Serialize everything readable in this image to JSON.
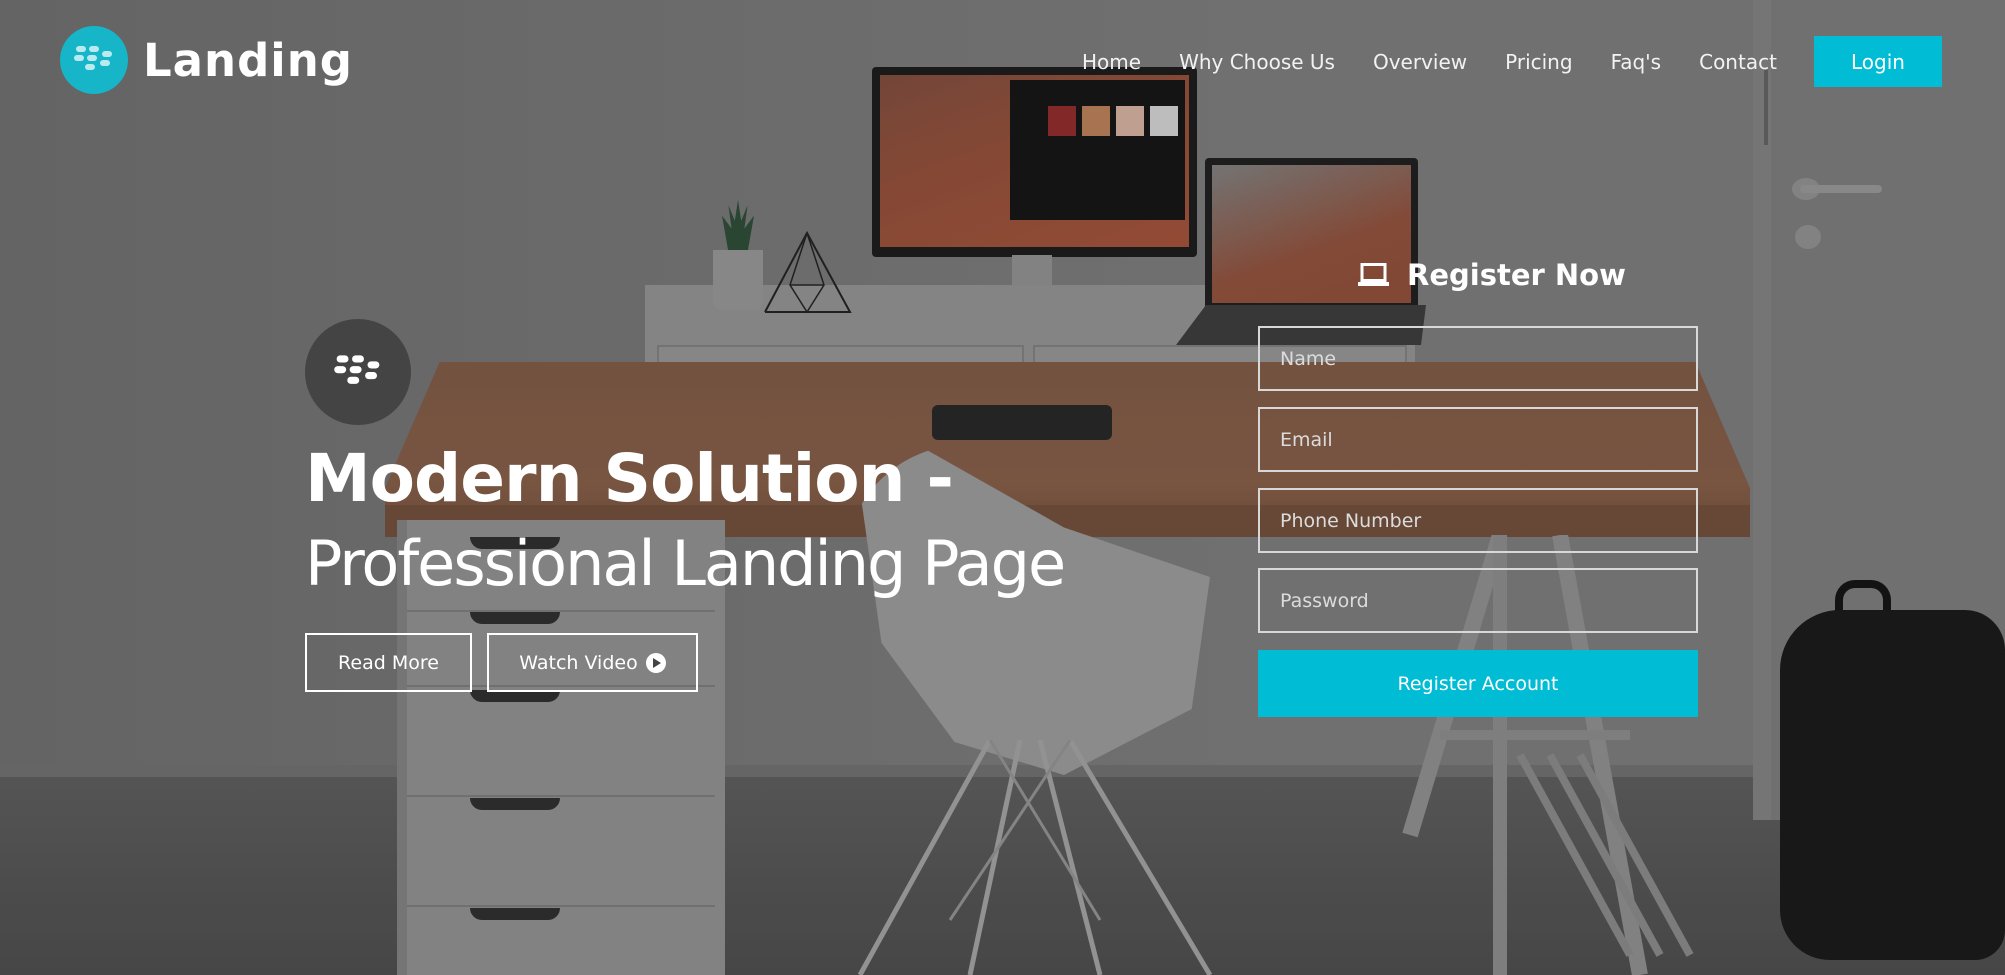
{
  "brand": {
    "name": "Landing",
    "logo_icon": "blackberry-logo-icon",
    "accent_color": "#00bcd4"
  },
  "nav": {
    "items": [
      {
        "label": "Home"
      },
      {
        "label": "Why Choose Us"
      },
      {
        "label": "Overview"
      },
      {
        "label": "Pricing"
      },
      {
        "label": "Faq's"
      },
      {
        "label": "Contact"
      }
    ],
    "login_label": "Login"
  },
  "hero": {
    "badge_icon": "blackberry-logo-icon",
    "headline": "Modern Solution -",
    "subheadline": "Professional Landing Page",
    "read_more_label": "Read More",
    "watch_video_label": "Watch Video",
    "watch_video_icon": "play-circle-icon"
  },
  "register": {
    "title": "Register Now",
    "title_icon": "laptop-icon",
    "fields": [
      {
        "placeholder": "Name",
        "value": ""
      },
      {
        "placeholder": "Email",
        "value": ""
      },
      {
        "placeholder": "Phone Number",
        "value": ""
      },
      {
        "placeholder": "Password",
        "value": ""
      }
    ],
    "submit_label": "Register Account"
  },
  "background": {
    "description": "home office desk with monitor, laptop, white chair, drawer unit, door and backpack"
  }
}
